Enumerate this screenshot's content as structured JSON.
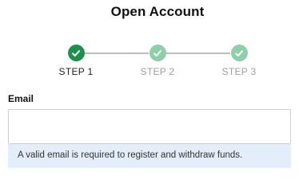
{
  "header": {
    "title": "Open Account"
  },
  "stepper": {
    "steps": [
      {
        "label": "STEP 1",
        "state": "active",
        "icon": "check-icon"
      },
      {
        "label": "STEP 2",
        "state": "inactive",
        "icon": "check-icon"
      },
      {
        "label": "STEP 3",
        "state": "inactive",
        "icon": "check-icon"
      }
    ],
    "colors": {
      "active": "#1f8f4e",
      "inactive": "#8ccfa8",
      "connector": "#bdbdbd"
    }
  },
  "form": {
    "email": {
      "label": "Email",
      "value": "",
      "placeholder": "",
      "hint": "A valid email is required to register and withdraw funds.",
      "hint_background": "#e3eefa"
    }
  }
}
